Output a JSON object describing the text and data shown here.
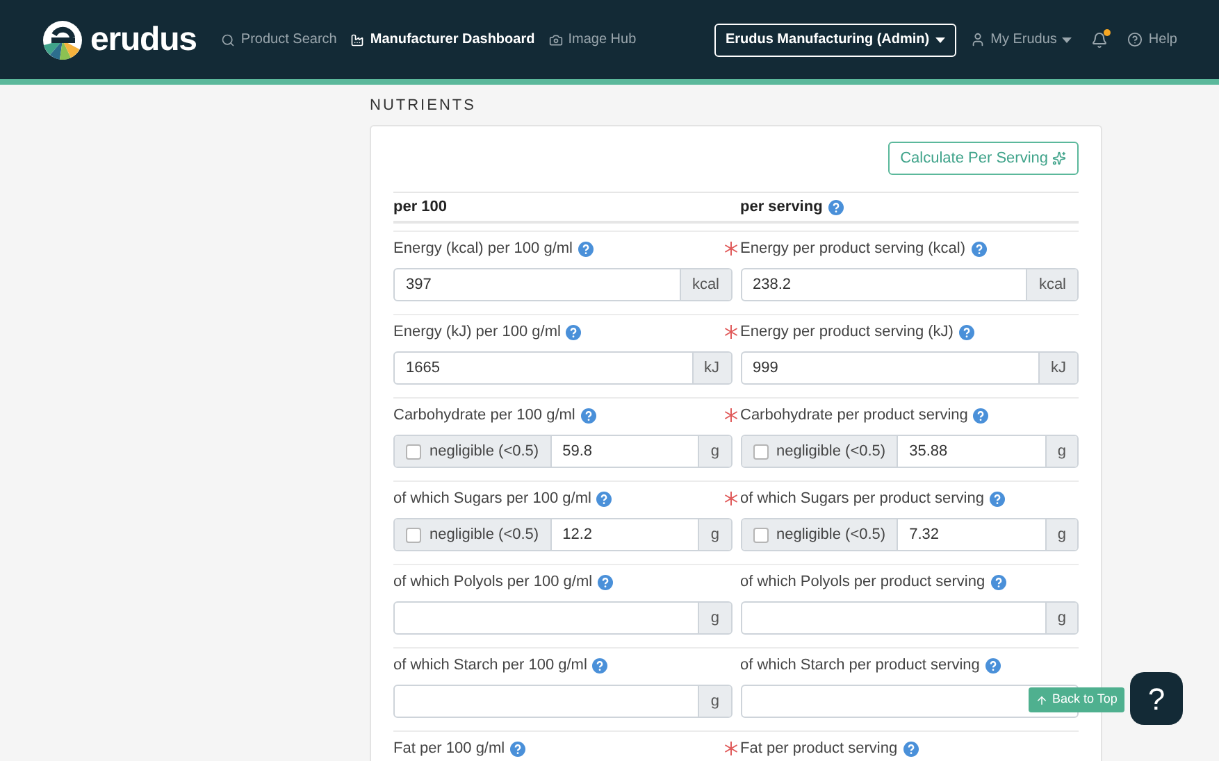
{
  "nav": {
    "brand": "erudus",
    "links": [
      {
        "label": "Product Search",
        "selected": false
      },
      {
        "label": "Manufacturer Dashboard",
        "selected": true
      },
      {
        "label": "Image Hub",
        "selected": false
      }
    ],
    "account_button": "Erudus Manufacturing (Admin)",
    "user_menu": "My Erudus",
    "notifications": {
      "unread": true
    },
    "help": "Help"
  },
  "section_title": "NUTRIENTS",
  "calculate_button": "Calculate Per Serving",
  "columns": [
    {
      "label": "per 100",
      "help": false
    },
    {
      "label": "per serving",
      "help": true
    }
  ],
  "rows": [
    {
      "required": true,
      "left": {
        "label": "Energy (kcal) per 100 g/ml",
        "kind": "plain",
        "value": "397",
        "unit": "kcal"
      },
      "right": {
        "label": "Energy per product serving (kcal)",
        "kind": "plain",
        "value": "238.2",
        "unit": "kcal"
      }
    },
    {
      "required": true,
      "left": {
        "label": "Energy (kJ) per 100 g/ml",
        "kind": "plain",
        "value": "1665",
        "unit": "kJ"
      },
      "right": {
        "label": "Energy per product serving (kJ)",
        "kind": "plain",
        "value": "999",
        "unit": "kJ"
      }
    },
    {
      "required": true,
      "left": {
        "label": "Carbohydrate per 100 g/ml",
        "kind": "negligible",
        "negligible_label": "negligible (<0.5)",
        "checked": false,
        "value": "59.8",
        "unit": "g"
      },
      "right": {
        "label": "Carbohydrate per product serving",
        "kind": "negligible",
        "negligible_label": "negligible (<0.5)",
        "checked": false,
        "value": "35.88",
        "unit": "g"
      }
    },
    {
      "required": true,
      "left": {
        "label": "of which Sugars per 100 g/ml",
        "kind": "negligible",
        "negligible_label": "negligible (<0.5)",
        "checked": false,
        "value": "12.2",
        "unit": "g"
      },
      "right": {
        "label": "of which Sugars per product serving",
        "kind": "negligible",
        "negligible_label": "negligible (<0.5)",
        "checked": false,
        "value": "7.32",
        "unit": "g"
      }
    },
    {
      "required": false,
      "left": {
        "label": "of which Polyols per 100 g/ml",
        "kind": "plain",
        "unit": "g"
      },
      "right": {
        "label": "of which Polyols per product serving",
        "kind": "plain",
        "unit": "g"
      }
    },
    {
      "required": false,
      "left": {
        "label": "of which Starch per 100 g/ml",
        "kind": "plain",
        "unit": "g"
      },
      "right": {
        "label": "of which Starch per product serving",
        "kind": "plain"
      }
    },
    {
      "required": true,
      "left": {
        "label": "Fat per 100 g/ml",
        "kind": "label_only"
      },
      "right": {
        "label": "Fat per product serving",
        "kind": "label_only"
      }
    }
  ],
  "back_to_top": "Back to Top",
  "help_bubble": "?"
}
